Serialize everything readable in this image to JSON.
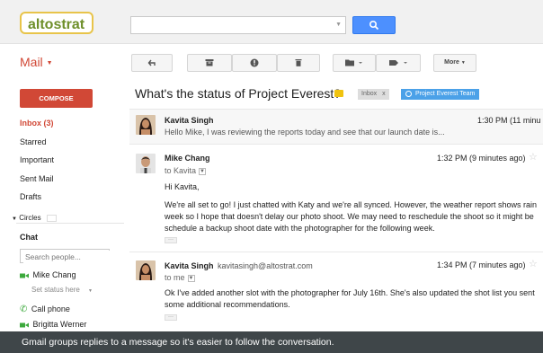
{
  "header": {
    "logo_text": "altostrat",
    "search": {
      "value": "",
      "placeholder": ""
    }
  },
  "toolbar": {
    "mail_label": "Mail",
    "more_label": "More"
  },
  "nav": {
    "compose_label": "COMPOSE",
    "items": [
      {
        "label": "Inbox (3)",
        "active": true
      },
      {
        "label": "Starred"
      },
      {
        "label": "Important"
      },
      {
        "label": "Sent Mail"
      },
      {
        "label": "Drafts"
      }
    ],
    "circles_label": "Circles"
  },
  "chat": {
    "heading": "Chat",
    "search_placeholder": "Search people...",
    "contacts": [
      {
        "name": "Mike Chang",
        "status": "Set status here",
        "icon": "video-icon"
      },
      {
        "name": "Call phone",
        "icon": "phone-icon"
      },
      {
        "name": "Brigitta Werner",
        "icon": "video-icon"
      }
    ]
  },
  "thread": {
    "subject": "What's the status of Project Everest?",
    "labels": [
      {
        "text": "Inbox",
        "close": "x",
        "color": "#dddddd"
      },
      {
        "text": "Project Everest Team",
        "color": "#4ba1e8"
      }
    ],
    "messages": [
      {
        "sender": "Kavita Singh",
        "time": "1:30 PM (11 minu",
        "snippet": "Hello Mike, I was reviewing the reports today and see that our launch date is..."
      },
      {
        "sender": "Mike Chang",
        "to": "to Kavita",
        "time": "1:32 PM (9 minutes ago)",
        "greeting": "Hi Kavita,",
        "body_lines": [
          "We're all set to go! I just chatted with Katy and we're all synced. However, the weather report shows rain",
          "week so I hope that doesn't delay our photo shoot. We may need to reschedule the shoot so it might be",
          "schedule a backup shoot date with the photographer for the following week."
        ]
      },
      {
        "sender": "Kavita Singh",
        "email": "kavitasingh@altostrat.com",
        "to": "to me",
        "time": "1:34 PM (7 minutes ago)",
        "body_lines": [
          "Ok I've added another slot with the photographer for July 16th. She's also updated the shot list you sent",
          "some additional recommendations."
        ]
      }
    ]
  },
  "caption": "Gmail groups replies to a message so it's easier to follow the conversation.",
  "colors": {
    "accent_red": "#d14836",
    "search_blue": "#4d90fe",
    "team_label_blue": "#4ba1e8",
    "label_yellow": "#f0c30f",
    "caption_bg": "#3f4649"
  }
}
